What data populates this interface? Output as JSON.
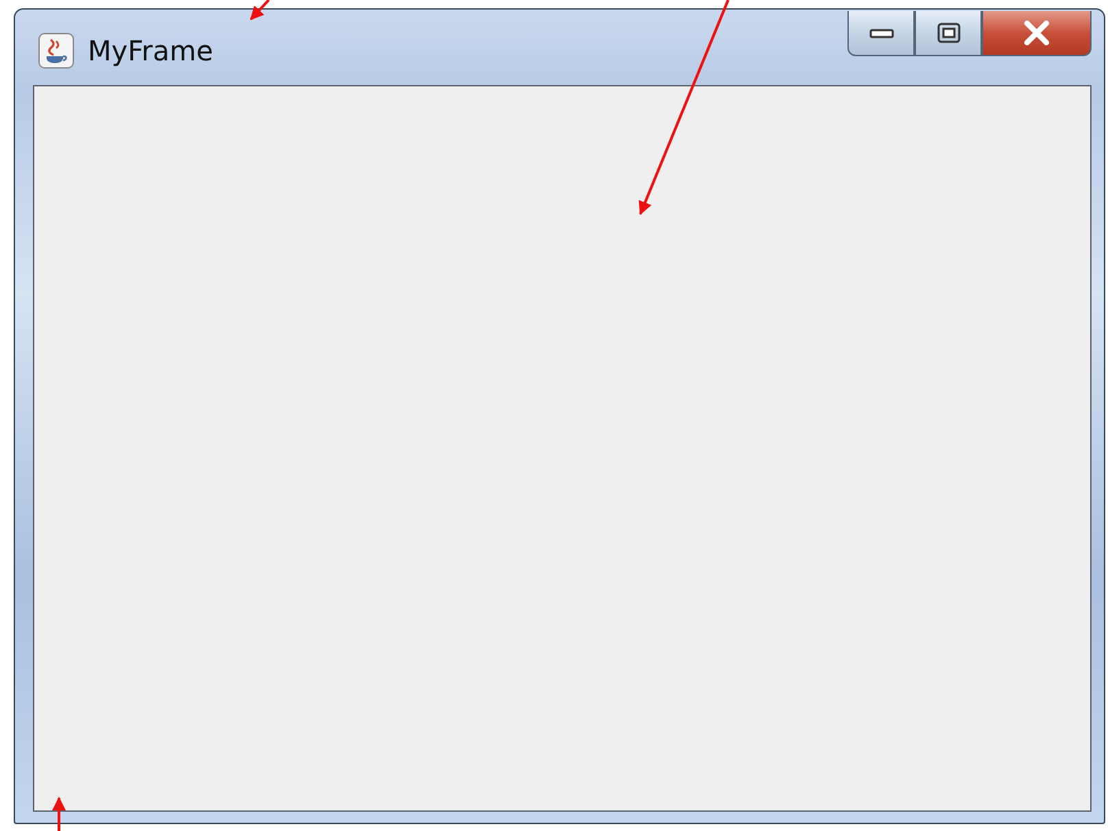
{
  "window": {
    "title": "MyFrame"
  }
}
